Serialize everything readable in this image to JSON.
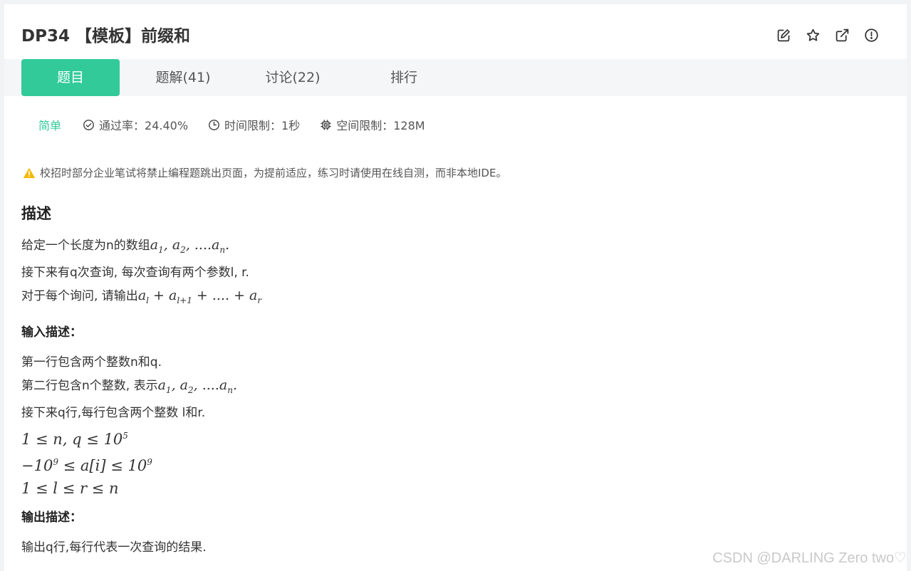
{
  "problem": {
    "title": "DP34  【模板】前缀和"
  },
  "tabs": [
    {
      "label": "题目",
      "active": true
    },
    {
      "label": "题解(41)",
      "active": false
    },
    {
      "label": "讨论(22)",
      "active": false
    },
    {
      "label": "排行",
      "active": false
    }
  ],
  "meta": {
    "difficulty": "简单",
    "pass_rate": "通过率：24.40%",
    "time_limit": "时间限制：1秒",
    "space_limit": "空间限制：128M"
  },
  "warning": "校招时部分企业笔试将禁止编程题跳出页面，为提前适应，练习时请使用在线自测，而非本地IDE。",
  "description": {
    "heading": "描述",
    "line1_prefix": "给定一个长度为n的数组",
    "line2": "接下来有q次查询, 每次查询有两个参数l, r.",
    "line3_prefix": "对于每个询问, 请输出"
  },
  "input": {
    "heading": "输入描述：",
    "line1": "第一行包含两个整数n和q.",
    "line2_prefix": "第二行包含n个整数, 表示",
    "line3": "接下来q行,每行包含两个整数   l和r."
  },
  "output": {
    "heading": "输出描述：",
    "line1": "输出q行,每行代表一次查询的结果."
  },
  "watermark": "CSDN @DARLING Zero two♡",
  "colors": {
    "accent": "#32ca99",
    "warning": "#f5b800"
  },
  "icons": [
    "edit-icon",
    "star-icon",
    "share-icon",
    "report-icon",
    "check-circle-icon",
    "clock-icon",
    "chip-icon",
    "warning-icon"
  ]
}
